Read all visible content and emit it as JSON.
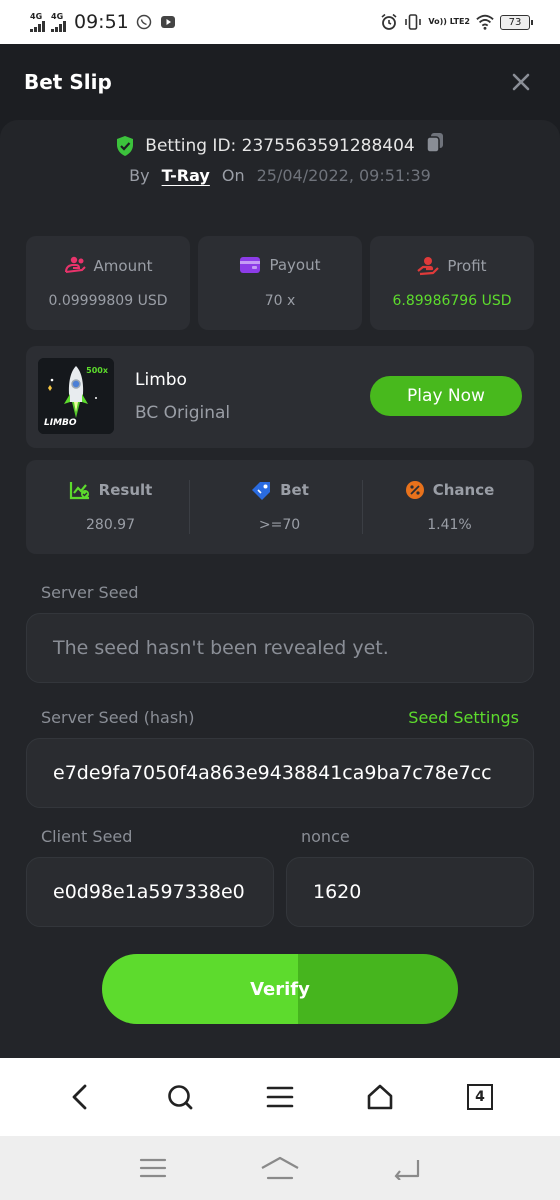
{
  "status_bar": {
    "network_1": "4G",
    "network_2": "4G",
    "time": "09:51",
    "volte": "Vo)) LTE2",
    "battery": "73",
    "icons": [
      "whatsapp-icon",
      "youtube-icon",
      "alarm-icon",
      "vibrate-icon",
      "wifi-icon"
    ]
  },
  "header": {
    "title": "Bet Slip",
    "close_icon": "close-icon"
  },
  "bet_info": {
    "betting_id": "Betting ID: 2375563591288404",
    "by_label": "By",
    "user": "T-Ray",
    "on_label": "On",
    "datetime": "25/04/2022, 09:51:39"
  },
  "stats": {
    "amount_label": "Amount",
    "amount_value": "0.09999809 USD",
    "payout_label": "Payout",
    "payout_value": "70 x",
    "profit_label": "Profit",
    "profit_value": "6.89986796 USD"
  },
  "game": {
    "thumb_badge": "500x",
    "thumb_logo": "LIMBO",
    "name": "Limbo",
    "subtitle": "BC Original",
    "play_label": "Play Now"
  },
  "round": {
    "result_label": "Result",
    "result_value": "280.97",
    "bet_label": "Bet",
    "bet_value": ">=70",
    "chance_label": "Chance",
    "chance_value": "1.41%"
  },
  "fairness": {
    "server_seed_label": "Server Seed",
    "server_seed_placeholder": "The seed hasn't been revealed yet.",
    "server_hash_label": "Server Seed (hash)",
    "seed_settings_label": "Seed Settings",
    "server_hash_value": "e7de9fa7050f4a863e9438841ca9ba7c78e7cc",
    "client_seed_label": "Client Seed",
    "client_seed_value": "e0d98e1a597338e0",
    "nonce_label": "nonce",
    "nonce_value": "1620",
    "verify_label": "Verify"
  },
  "browser_bar": {
    "tab_count": "4"
  },
  "colors": {
    "accent_green": "#5ddb2d",
    "button_green": "#48b91d",
    "panel": "#232529",
    "card": "#2c2e33"
  }
}
